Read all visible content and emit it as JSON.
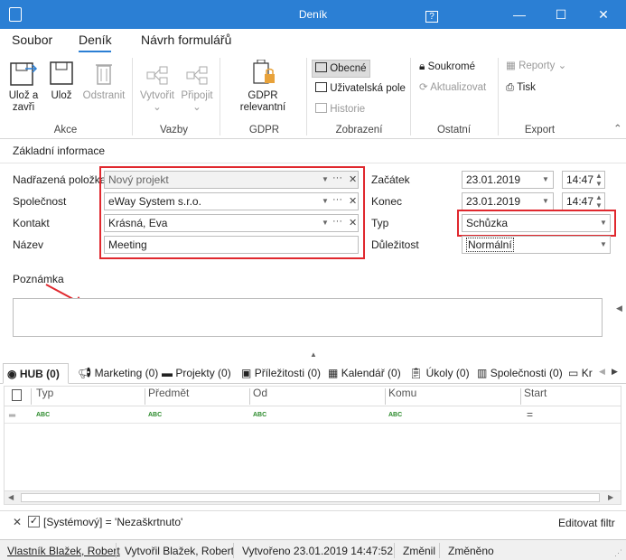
{
  "window": {
    "title": "Deník",
    "help": "?",
    "minimize": "—",
    "maximize": "☐",
    "close": "✕"
  },
  "menu": {
    "tabs": [
      "Soubor",
      "Deník",
      "Návrh formulářů"
    ]
  },
  "ribbon": {
    "akce": {
      "label": "Akce",
      "save_close": "Ulož a",
      "save_close2": "zavři",
      "save": "Ulož",
      "delete": "Odstranit"
    },
    "vazby": {
      "label": "Vazby",
      "create": "Vytvořit",
      "attach": "Připojit"
    },
    "gdpr": {
      "label": "GDPR",
      "relevant": "GDPR relevantní"
    },
    "zobrazeni": {
      "label": "Zobrazení",
      "general": "Obecné",
      "user_fields": "Uživatelská pole",
      "history": "Historie"
    },
    "ostatni": {
      "label": "Ostatní",
      "private": "Soukromé",
      "refresh": "Aktualizovat"
    },
    "export": {
      "label": "Export",
      "reports": "Reporty",
      "print": "Tisk"
    }
  },
  "form": {
    "section_title": "Základní informace",
    "parent_label": "Nadřazená položka",
    "parent_value": "Nový projekt",
    "company_label": "Společnost",
    "company_value": "eWay System s.r.o.",
    "contact_label": "Kontakt",
    "contact_value": "Krásná, Eva",
    "name_label": "Název",
    "name_value": "Meeting",
    "start_label": "Začátek",
    "start_date": "23.01.2019",
    "start_time": "14:47",
    "end_label": "Konec",
    "end_date": "23.01.2019",
    "end_time": "14:47",
    "type_label": "Typ",
    "type_value": "Schůzka",
    "importance_label": "Důležitost",
    "importance_value": "Normální",
    "note_label": "Poznámka"
  },
  "tabs": [
    "HUB (0)",
    "Marketing (0)",
    "Projekty (0)",
    "Příležitosti (0)",
    "Kalendář (0)",
    "Úkoly (0)",
    "Společnosti (0)",
    "Kr"
  ],
  "grid": {
    "columns": [
      "Typ",
      "Předmět",
      "Od",
      "Komu",
      "Start"
    ],
    "filter_row": [
      "ABC",
      "ABC",
      "ABC",
      "ABC",
      "="
    ]
  },
  "filter": {
    "text": "[Systémový] = 'Nezaškrtnuto'",
    "edit": "Editovat filtr"
  },
  "status": {
    "owner": "Vlastník Blažek, Robert",
    "created_by": "Vytvořil Blažek, Robert",
    "created": "Vytvořeno 23.01.2019 14:47:52",
    "changed": "Změnil",
    "changed_at": "Změněno"
  }
}
